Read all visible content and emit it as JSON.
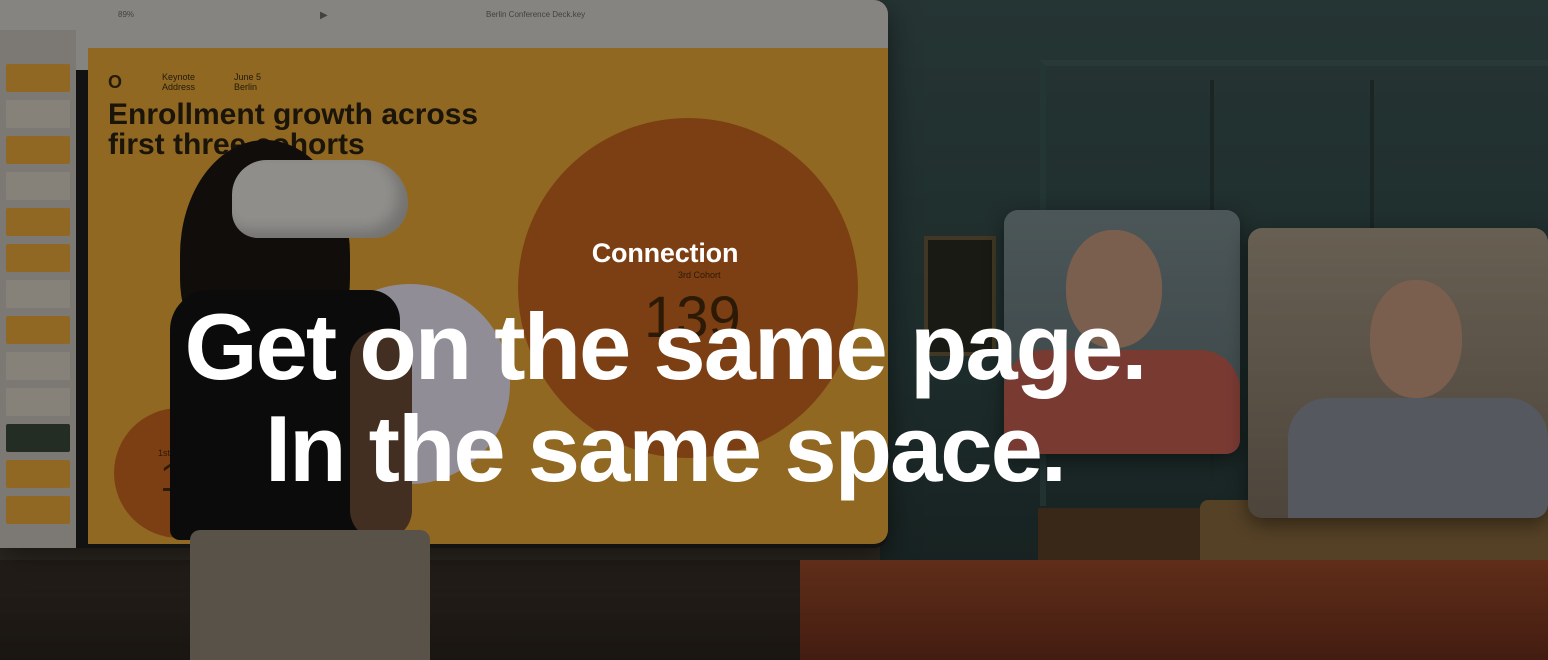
{
  "section": {
    "eyebrow": "Connection",
    "headline_line1": "Get on the same page.",
    "headline_line2": "In the same space."
  },
  "scene": {
    "keynote_window": {
      "toolbar_zoom": "89%",
      "document_title": "Berlin Conference Deck.key",
      "slide": {
        "logo_text": "O",
        "meta_1": "Keynote Address",
        "meta_2": "June 5 Berlin",
        "title": "Enrollment growth across first three cohorts",
        "cohort_3_label": "3rd Cohort",
        "cohort_3_value": "139",
        "cohort_1_label": "1st",
        "cohort_1_value": "1"
      }
    }
  },
  "colors": {
    "slide_bg": "#e8a937",
    "circle_dark": "#c9661f",
    "circle_light": "#e8e4f2",
    "text_white": "#ffffff"
  }
}
